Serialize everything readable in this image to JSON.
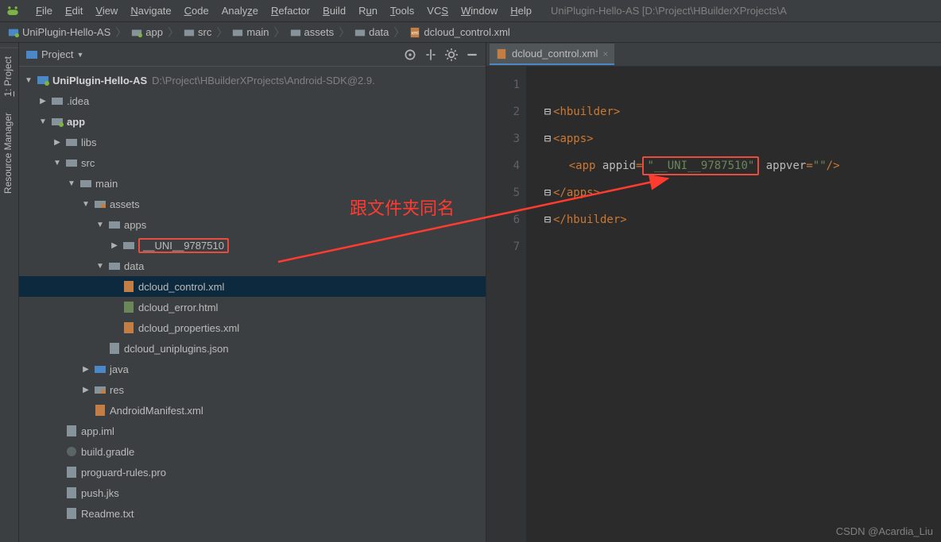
{
  "menubar": {
    "items": [
      "File",
      "Edit",
      "View",
      "Navigate",
      "Code",
      "Analyze",
      "Refactor",
      "Build",
      "Run",
      "Tools",
      "VCS",
      "Window",
      "Help"
    ],
    "title": "UniPlugin-Hello-AS [D:\\Project\\HBuilderXProjects\\A"
  },
  "breadcrumb": {
    "items": [
      "UniPlugin-Hello-AS",
      "app",
      "src",
      "main",
      "assets",
      "data",
      "dcloud_control.xml"
    ]
  },
  "panel": {
    "title": "Project",
    "root": {
      "name": "UniPlugin-Hello-AS",
      "path": "D:\\Project\\HBuilderXProjects\\Android-SDK@2.9."
    },
    "nodes": {
      "idea": ".idea",
      "app": "app",
      "libs": "libs",
      "src": "src",
      "main": "main",
      "assets": "assets",
      "apps": "apps",
      "uni_folder": "__UNI__9787510",
      "data": "data",
      "dcloud_control": "dcloud_control.xml",
      "dcloud_error": "dcloud_error.html",
      "dcloud_properties": "dcloud_properties.xml",
      "dcloud_uniplugins": "dcloud_uniplugins.json",
      "java": "java",
      "res": "res",
      "manifest": "AndroidManifest.xml",
      "appiml": "app.iml",
      "buildgradle": "build.gradle",
      "proguard": "proguard-rules.pro",
      "pushjks": "push.jks",
      "readme": "Readme.txt"
    }
  },
  "editor": {
    "tab": "dcloud_control.xml",
    "lines": [
      "1",
      "2",
      "3",
      "4",
      "5",
      "6",
      "7"
    ],
    "code": {
      "l2": {
        "open": "<",
        "tag": "hbuilder",
        "close": ">"
      },
      "l3": {
        "open": "<",
        "tag": "apps",
        "close": ">"
      },
      "l4": {
        "open": "<",
        "tag": "app",
        "attr1": " appid",
        "eq": "=",
        "val1": "\"__UNI__9787510\"",
        "attr2": " appver",
        "val2": "\"\"",
        "slash": "/>"
      },
      "l5": {
        "open": "</",
        "tag": "apps",
        "close": ">"
      },
      "l6": {
        "open": "</",
        "tag": "hbuilder",
        "close": ">"
      }
    }
  },
  "annotation": {
    "text": "跟文件夹同名"
  },
  "watermark": "CSDN @Acardia_Liu"
}
